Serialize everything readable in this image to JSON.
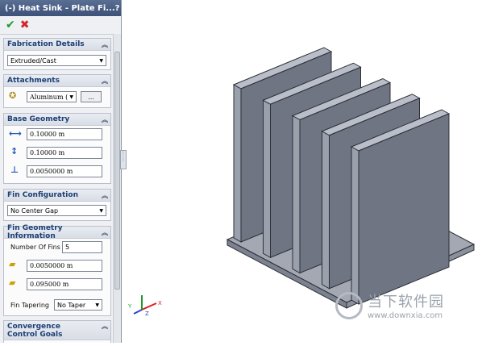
{
  "panel": {
    "title": "(-) Heat Sink - Plate Fi...",
    "help": "?",
    "ok_icon": "checkmark-icon",
    "cancel_icon": "close-icon"
  },
  "fabrication": {
    "header": "Fabrication Details",
    "value": "Extruded/Cast"
  },
  "attachments": {
    "header": "Attachments",
    "material": "Aluminum (",
    "browse": "..."
  },
  "base_geometry": {
    "header": "Base Geometry",
    "width": "0.10000 m",
    "length": "0.10000 m",
    "thickness": "0.0050000 m"
  },
  "fin_config": {
    "header": "Fin Configuration",
    "value": "No Center Gap"
  },
  "fin_geometry": {
    "header": "Fin Geometry Information",
    "num_label": "Number Of Fins",
    "num_value": "5",
    "fin_thickness": "0.0050000 m",
    "fin_height": "0.095000 m",
    "taper_label": "Fin Tapering",
    "taper_value": "No Taper"
  },
  "convergence": {
    "header": "Convergence Control Goals"
  },
  "triad": {
    "x": "X",
    "y": "Y",
    "z": "Z"
  },
  "watermark": {
    "main": "当下软件园",
    "url": "www.downxia.com"
  },
  "colors": {
    "fin_front": "#6f7583",
    "fin_side": "#9aa0ac",
    "fin_top": "#b9bec8",
    "edge": "#2b2f37"
  }
}
